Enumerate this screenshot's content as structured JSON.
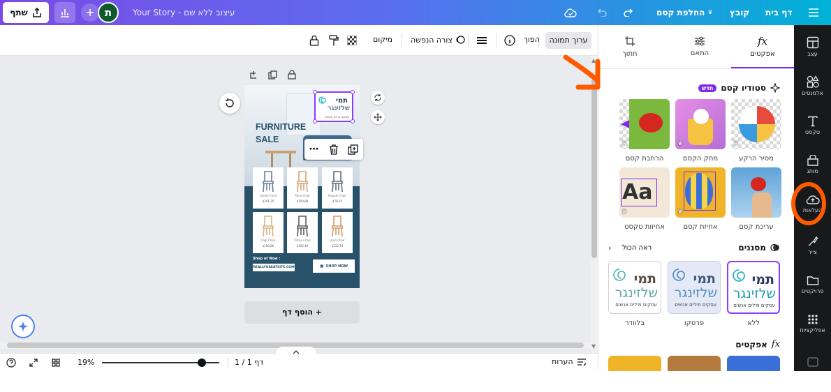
{
  "topbar": {
    "menu_home": "דף בית",
    "menu_file": "קובץ",
    "menu_magic": "החלפת קסם",
    "doc_title": "עיצוב ללא שם - Your Story",
    "avatar_letter": "ת",
    "share_label": "שתף",
    "accent": "#7d2ae8"
  },
  "siderail": {
    "items": [
      {
        "label": "עצב",
        "icon": "layout-icon"
      },
      {
        "label": "אלמנטים",
        "icon": "elements-icon"
      },
      {
        "label": "טקסט",
        "icon": "text-icon"
      },
      {
        "label": "מותג",
        "icon": "brand-icon"
      },
      {
        "label": "העלאות",
        "icon": "upload-icon"
      },
      {
        "label": "צייר",
        "icon": "draw-icon"
      },
      {
        "label": "פרויקטים",
        "icon": "folder-icon"
      },
      {
        "label": "אפליקציות",
        "icon": "apps-icon"
      }
    ]
  },
  "panel": {
    "tabs": [
      {
        "label": "אפקטים",
        "icon": "fx-icon"
      },
      {
        "label": "התאם",
        "icon": "adjust-icon"
      },
      {
        "label": "חתוך",
        "icon": "crop-icon"
      }
    ],
    "studio_title": "סטודיו קסם",
    "studio_badge": "חדש",
    "tools": [
      {
        "label": "מסיר הרקע"
      },
      {
        "label": "מחק הקסם"
      },
      {
        "label": "הרחבת קסם"
      },
      {
        "label": "עריכת קסם"
      },
      {
        "label": "אחיזת קסם"
      },
      {
        "label": "אחיזות טקסט"
      }
    ],
    "filters_title": "מסננים",
    "see_all": "ראה הכול",
    "filters": [
      {
        "label": "ללא"
      },
      {
        "label": "פרסקו"
      },
      {
        "label": "בלוודר"
      }
    ],
    "effects_title": "אפקטים",
    "logo_line1": "תמי",
    "logo_line2": "שלזינגר",
    "logo_line3": "עסקים מילים אנשים"
  },
  "toolbar": {
    "edit_image": "ערוך תמונה",
    "flip": "הפוך",
    "shape": "צורה הנפשה",
    "position": "מיקום"
  },
  "design": {
    "title_line1": "FURNITURE",
    "title_line2": "SALE",
    "logo_line1": "תמי",
    "logo_line2": "שלזינגר",
    "logo_line3": "עסקים מילים אנשים",
    "products": [
      {
        "name": "Cassie Chair",
        "price": "$101,35"
      },
      {
        "name": "Alina Chair",
        "price": "$100,88"
      },
      {
        "name": "Hoppie Chair",
        "price": "$78,10"
      },
      {
        "name": "Cagi Chair",
        "price": "$100,26"
      },
      {
        "name": "Vitrae Chair",
        "price": "$105,40"
      },
      {
        "name": "Isom Chair",
        "price": "$112,70"
      }
    ],
    "shop_label": "Shop at Now :",
    "website": "REALLYGREATSITE.COM",
    "shop_button": "SHOP NOW",
    "bg_color": "#28526a"
  },
  "canvas": {
    "add_page": "+ הוסף דף"
  },
  "bottombar": {
    "notes": "הערות",
    "page_indicator": "דף 1 / 1",
    "zoom": "19%",
    "zoom_fraction": 0.15
  }
}
